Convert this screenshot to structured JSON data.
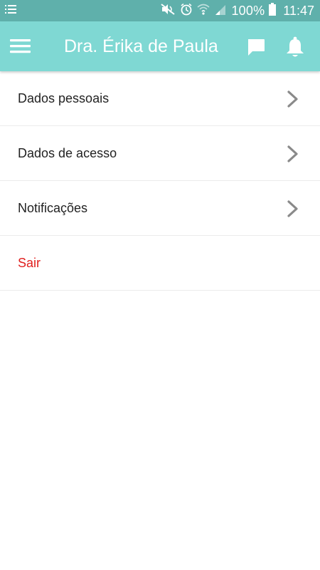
{
  "status_bar": {
    "battery_percent_label": "100%",
    "time": "11:47",
    "icons": [
      "notification-list-icon",
      "mute-icon",
      "alarm-icon",
      "wifi-icon",
      "signal-icon",
      "battery-icon"
    ]
  },
  "app_bar": {
    "title": "Dra. Érika de Paula",
    "icons": [
      "menu-icon",
      "chat-icon",
      "bell-icon"
    ],
    "background_color": "#7fd8d3"
  },
  "settings_list": {
    "items": [
      {
        "label": "Dados pessoais"
      },
      {
        "label": "Dados de acesso"
      },
      {
        "label": "Notificações"
      }
    ],
    "logout_label": "Sair",
    "logout_color": "#e0201f"
  }
}
